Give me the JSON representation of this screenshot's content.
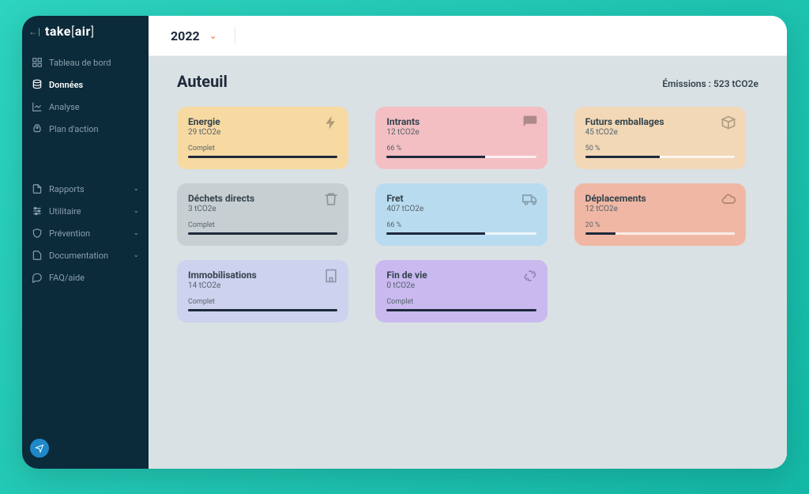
{
  "brand": {
    "text1": "take",
    "bracket_open": "[",
    "text2": "air",
    "bracket_close": "]"
  },
  "sidebar": {
    "primary": [
      {
        "label": "Tableau de bord",
        "icon": "dashboard-icon"
      },
      {
        "label": "Données",
        "icon": "data-icon",
        "active": true
      },
      {
        "label": "Analyse",
        "icon": "chart-icon"
      },
      {
        "label": "Plan d'action",
        "icon": "rocket-icon"
      }
    ],
    "secondary": [
      {
        "label": "Rapports",
        "icon": "file-icon",
        "expandable": true
      },
      {
        "label": "Utilitaire",
        "icon": "sliders-icon",
        "expandable": true
      },
      {
        "label": "Prévention",
        "icon": "shield-icon",
        "expandable": true
      },
      {
        "label": "Documentation",
        "icon": "doc-icon",
        "expandable": true
      },
      {
        "label": "FAQ/aide",
        "icon": "chat-icon"
      }
    ]
  },
  "topbar": {
    "year": "2022"
  },
  "page": {
    "title": "Auteuil",
    "emissions_label": "Émissions : 523 tCO2e"
  },
  "cards": [
    {
      "key": "energie",
      "title": "Energie",
      "value": "29 tCO2e",
      "status": "Complet",
      "progress": 100,
      "class": "c-energie",
      "icon": "bolt-icon"
    },
    {
      "key": "intrants",
      "title": "Intrants",
      "value": "12 tCO2e",
      "status": "66 %",
      "progress": 66,
      "class": "c-intrants",
      "icon": "chat-bubble-icon"
    },
    {
      "key": "emballages",
      "title": "Futurs emballages",
      "value": "45 tCO2e",
      "status": "50 %",
      "progress": 50,
      "class": "c-emballages",
      "icon": "package-icon"
    },
    {
      "key": "dechets",
      "title": "Déchets directs",
      "value": "3 tCO2e",
      "status": "Complet",
      "progress": 100,
      "class": "c-dechets",
      "icon": "trash-icon"
    },
    {
      "key": "fret",
      "title": "Fret",
      "value": "407 tCO2e",
      "status": "66 %",
      "progress": 66,
      "class": "c-fret",
      "icon": "truck-icon"
    },
    {
      "key": "deplacements",
      "title": "Déplacements",
      "value": "12 tCO2e",
      "status": "20 %",
      "progress": 20,
      "class": "c-deplacements",
      "icon": "cloud-icon"
    },
    {
      "key": "immobilisations",
      "title": "Immobilisations",
      "value": "14 tCO2e",
      "status": "Complet",
      "progress": 100,
      "class": "c-immobilisations",
      "icon": "building-icon"
    },
    {
      "key": "findevie",
      "title": "Fin de vie",
      "value": "0 tCO2e",
      "status": "Complet",
      "progress": 100,
      "class": "c-findevie",
      "icon": "recycle-icon"
    }
  ]
}
